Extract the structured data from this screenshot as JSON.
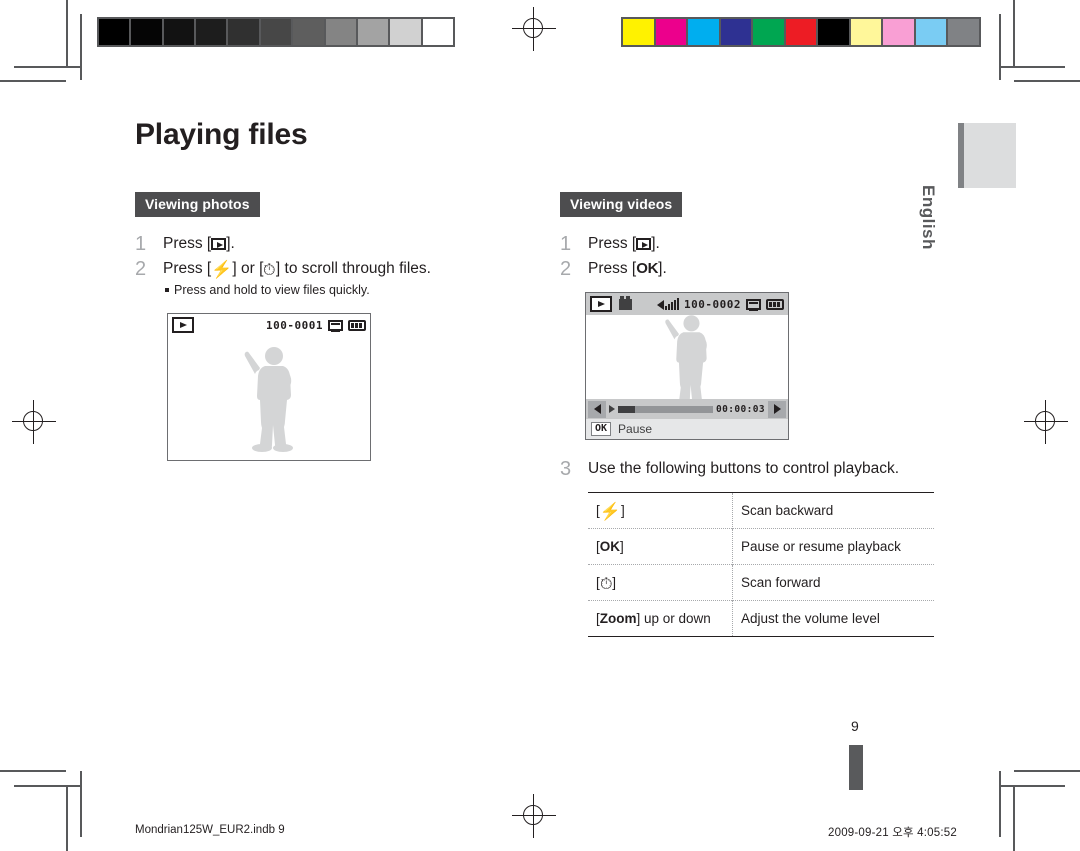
{
  "page": {
    "title": "Playing files",
    "page_number": "9",
    "language_tab": "English"
  },
  "left_column": {
    "section_tag": "Viewing photos",
    "steps": [
      {
        "num": "1",
        "text_before": "Press [",
        "key": "play-button-icon",
        "text_after": "]."
      },
      {
        "num": "2",
        "text_before": "Press [",
        "key": "flash-button-icon",
        "text_mid": "] or [",
        "key2": "timer-button-icon",
        "text_after": "] to scroll through files.",
        "note": "Press and hold to view files quickly."
      }
    ],
    "lcd": {
      "file_number": "100-0001",
      "icons": [
        "play-mode-icon",
        "memory-card-icon",
        "battery-icon"
      ]
    }
  },
  "right_column": {
    "section_tag": "Viewing videos",
    "steps": [
      {
        "num": "1",
        "text_before": "Press [",
        "key": "play-button-icon",
        "text_after": "]."
      },
      {
        "num": "2",
        "text_before": "Press [",
        "key": "OK",
        "text_after": "]."
      },
      {
        "num": "3",
        "text": "Use the following buttons to control playback."
      }
    ],
    "lcd": {
      "file_number": "100-0002",
      "elapsed_time": "00:00:03",
      "status_key": "OK",
      "status_label": "Pause",
      "rewind_label": "REW",
      "forward_label": "FF",
      "icons": [
        "play-mode-icon",
        "movie-clip-icon",
        "volume-icon",
        "memory-card-icon",
        "battery-icon"
      ]
    },
    "button_table": {
      "rows": [
        {
          "key_prefix": "[",
          "key_glyph": "flash-button-icon",
          "key_suffix": "]",
          "description": "Scan backward"
        },
        {
          "key_prefix": "[",
          "key_text": "OK",
          "key_suffix": "]",
          "description": "Pause or resume playback"
        },
        {
          "key_prefix": "[",
          "key_glyph": "timer-button-icon",
          "key_suffix": "]",
          "description": "Scan forward"
        },
        {
          "key_prefix": "[",
          "key_text": "Zoom",
          "key_suffix": "] up or down",
          "description": "Adjust the volume level"
        }
      ]
    }
  },
  "footer": {
    "file_name": "Mondrian125W_EUR2.indb   9",
    "timestamp": "2009-09-21   오후 4:05:52"
  },
  "print_marks": {
    "gray_strip": [
      "#000000",
      "#050505",
      "#121212",
      "#1d1d1d",
      "#303030",
      "#474747",
      "#5e5e5e",
      "#848484",
      "#a3a3a3",
      "#d1d1d1",
      "#ffffff"
    ],
    "color_strip": [
      "#fff200",
      "#ec008c",
      "#00aeef",
      "#2e3192",
      "#00a651",
      "#ed1c24",
      "#000000",
      "#fff79a",
      "#f99fd4",
      "#7accf3",
      "#808285"
    ],
    "frame_color": "#58595b"
  }
}
